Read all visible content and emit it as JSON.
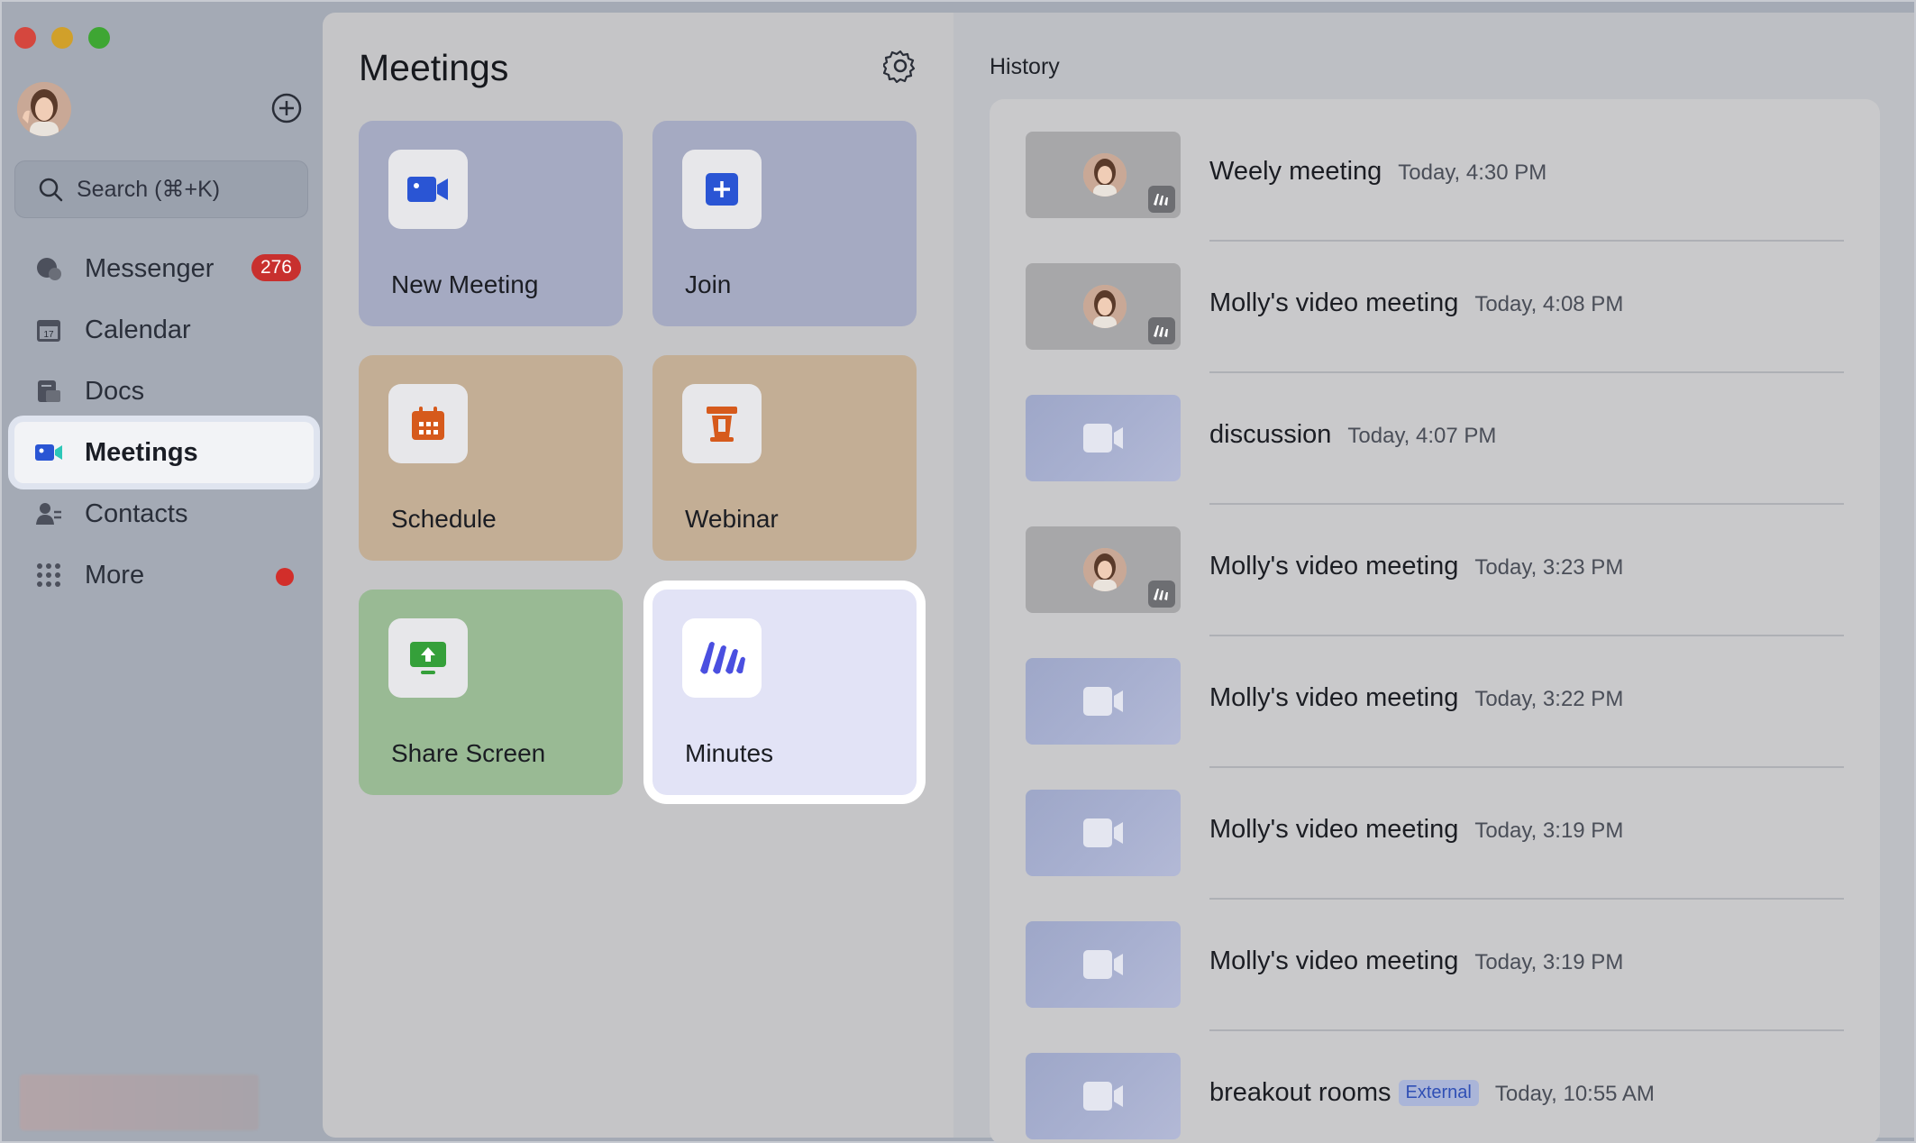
{
  "window": {
    "traffic_lights": [
      "close",
      "minimize",
      "zoom"
    ]
  },
  "sidebar": {
    "search_placeholder": "Search (⌘+K)",
    "items": [
      {
        "label": "Messenger",
        "icon": "messenger-icon",
        "badge": "276"
      },
      {
        "label": "Calendar",
        "icon": "calendar-icon",
        "icon_text": "17"
      },
      {
        "label": "Docs",
        "icon": "docs-icon"
      },
      {
        "label": "Meetings",
        "icon": "meetings-icon",
        "active": true
      },
      {
        "label": "Contacts",
        "icon": "contacts-icon"
      },
      {
        "label": "More",
        "icon": "grid-icon",
        "dot": true
      }
    ]
  },
  "meetings": {
    "title": "Meetings",
    "tiles": [
      {
        "label": "New Meeting",
        "icon": "video-camera-icon",
        "color": "#2a55d4"
      },
      {
        "label": "Join",
        "icon": "plus-square-icon",
        "color": "#2a55d4"
      },
      {
        "label": "Schedule",
        "icon": "calendar-grid-icon",
        "color": "#d65a1c"
      },
      {
        "label": "Webinar",
        "icon": "podium-icon",
        "color": "#d65a1c"
      },
      {
        "label": "Share Screen",
        "icon": "share-screen-icon",
        "color": "#35a03a"
      },
      {
        "label": "Minutes",
        "icon": "minutes-icon",
        "color": "#4a4fe0"
      }
    ]
  },
  "history": {
    "title": "History",
    "items": [
      {
        "name": "Weely meeting",
        "time": "Today, 4:30 PM",
        "thumb": "person"
      },
      {
        "name": "Molly's video meeting",
        "time": "Today, 4:08 PM",
        "thumb": "person"
      },
      {
        "name": "discussion",
        "time": "Today, 4:07 PM",
        "thumb": "video"
      },
      {
        "name": "Molly's video meeting",
        "time": "Today, 3:23 PM",
        "thumb": "person"
      },
      {
        "name": "Molly's video meeting",
        "time": "Today, 3:22 PM",
        "thumb": "video"
      },
      {
        "name": "Molly's video meeting",
        "time": "Today, 3:19 PM",
        "thumb": "video"
      },
      {
        "name": "Molly's video meeting",
        "time": "Today, 3:19 PM",
        "thumb": "video"
      },
      {
        "name": "breakout rooms",
        "tag": "External",
        "time": "Today, 10:55 AM",
        "thumb": "video"
      }
    ]
  }
}
